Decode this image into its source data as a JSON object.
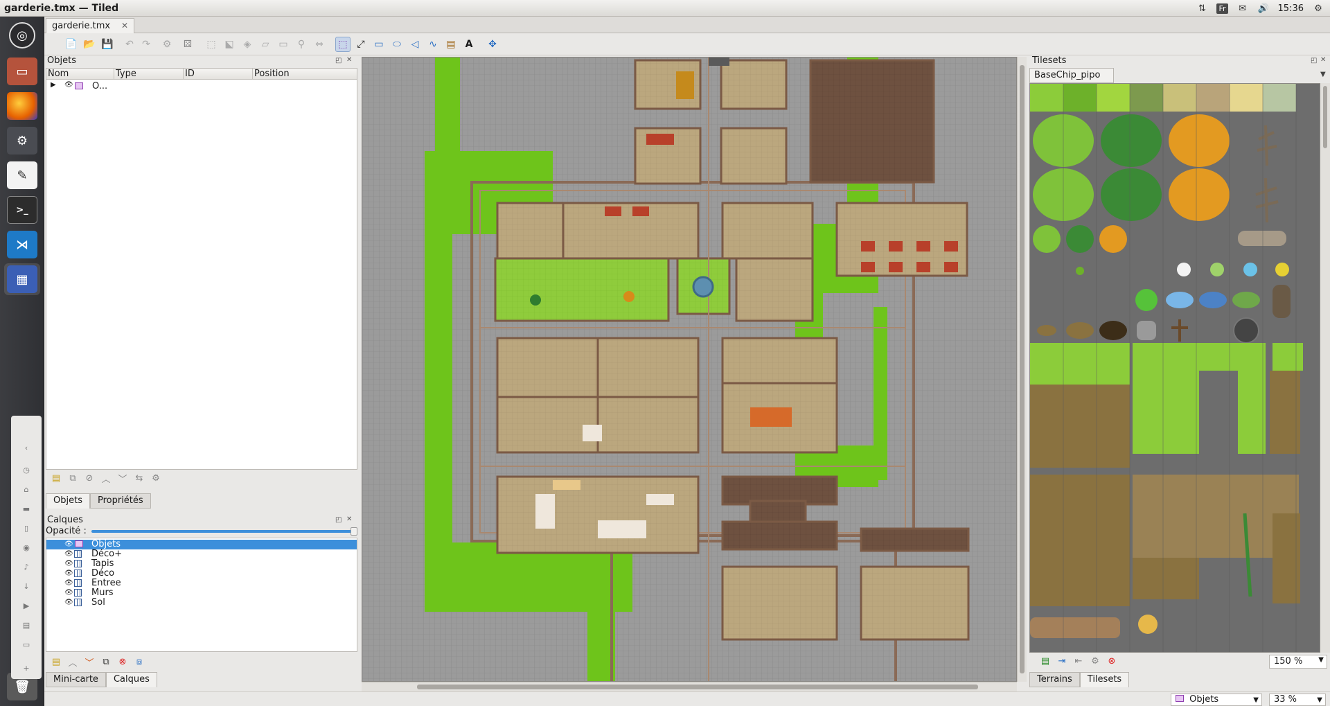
{
  "window": {
    "title": "garderie.tmx — Tiled"
  },
  "tray": {
    "keyboard": "Fr",
    "clock": "15:36"
  },
  "document_tab": {
    "label": "garderie.tmx"
  },
  "objects_panel": {
    "title": "Objets",
    "columns": [
      "Nom",
      "Type",
      "ID",
      "Position"
    ],
    "rows": [
      {
        "name": "O..."
      }
    ],
    "tabs": [
      "Objets",
      "Propriétés"
    ]
  },
  "layers_panel": {
    "title": "Calques",
    "opacity_label": "Opacité :",
    "layers": [
      {
        "name": "Objets",
        "kind": "object"
      },
      {
        "name": "Déco+",
        "kind": "tile"
      },
      {
        "name": "Tapis",
        "kind": "tile"
      },
      {
        "name": "Déco",
        "kind": "tile"
      },
      {
        "name": "Entree",
        "kind": "tile"
      },
      {
        "name": "Murs",
        "kind": "tile"
      },
      {
        "name": "Sol",
        "kind": "tile"
      }
    ],
    "selected": "Objets",
    "tabs": [
      "Mini-carte",
      "Calques"
    ]
  },
  "tilesets_panel": {
    "title": "Tilesets",
    "tileset_name": "BaseChip_pipo",
    "zoom": "150 %",
    "tabs": [
      "Terrains",
      "Tilesets"
    ]
  },
  "status_bar": {
    "layer_combo": "Objets",
    "zoom": "33 %"
  },
  "colors": {
    "selection": "#3c8fdb",
    "grass": "#72c81e",
    "floor": "#b9a47a",
    "wall": "#7b5a45",
    "road": "#9a9a9a"
  }
}
